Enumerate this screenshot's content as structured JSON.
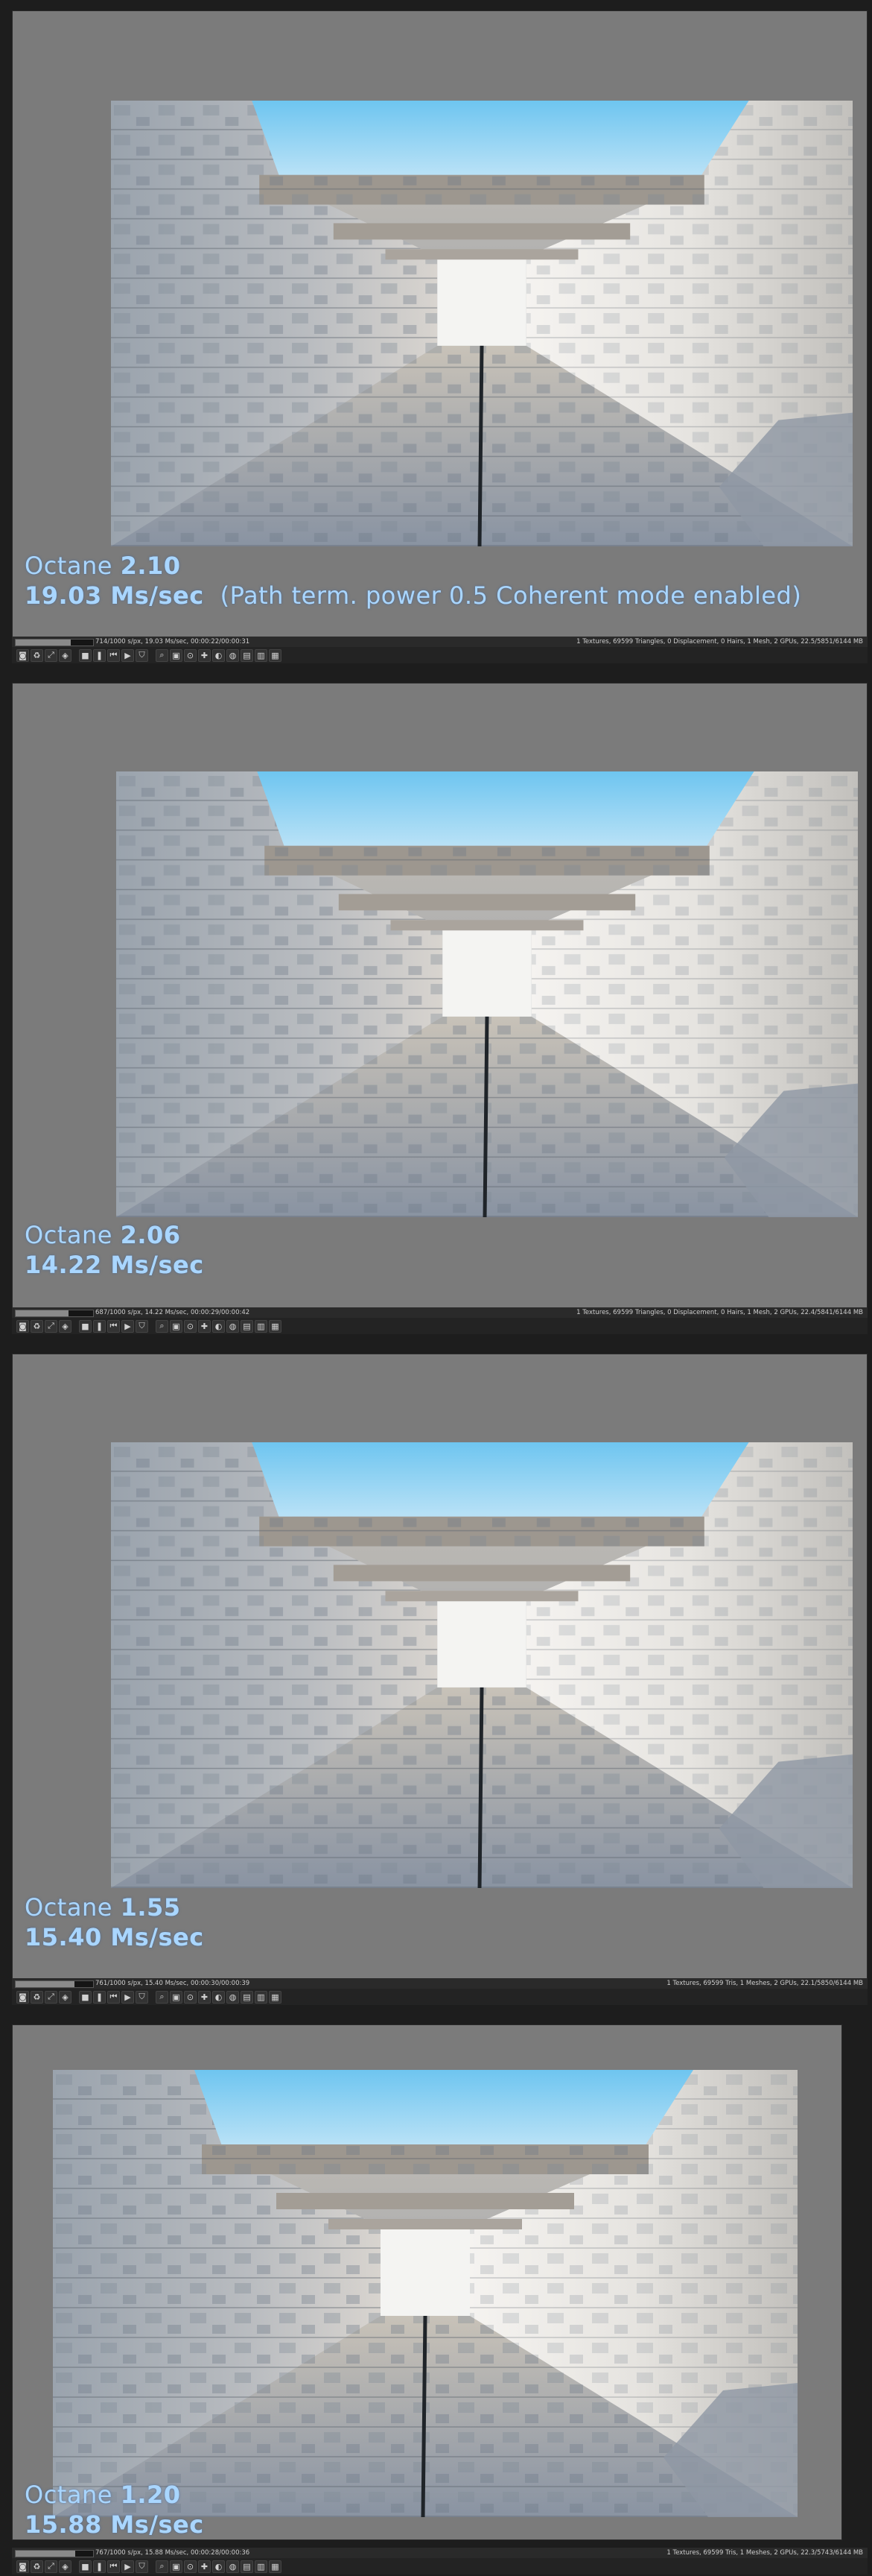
{
  "panels": [
    {
      "version_label": "Octane ",
      "version": "2.10",
      "speed": "19.03 Ms/sec",
      "extra": "(Path term. power 0.5  Coherent mode enabled)",
      "status_left": "714/1000 s/px, 19.03 Ms/sec, 00:00:22/00:00:31",
      "status_right": "1 Textures, 69599 Triangles, 0 Displacement, 0 Hairs, 1 Mesh, 2 GPUs, 22.5/5851/6144 MB",
      "progress": 0.714
    },
    {
      "version_label": "Octane ",
      "version": "2.06",
      "speed": "14.22 Ms/sec",
      "extra": "",
      "status_left": "687/1000 s/px, 14.22 Ms/sec, 00:00:29/00:00:42",
      "status_right": "1 Textures, 69599 Triangles, 0 Displacement, 0 Hairs, 1 Mesh, 2 GPUs, 22.4/5841/6144 MB",
      "progress": 0.687
    },
    {
      "version_label": "Octane ",
      "version": "1.55",
      "speed": "15.40 Ms/sec",
      "extra": "",
      "status_left": "761/1000 s/px, 15.40 Ms/sec, 00:00:30/00:00:39",
      "status_right": "1 Textures, 69599 Tris, 1 Meshes, 2 GPUs, 22.1/5850/6144 MB",
      "progress": 0.761
    },
    {
      "version_label": "Octane ",
      "version": "1.20",
      "speed": "15.88 Ms/sec",
      "extra": "",
      "status_left": "767/1000 s/px, 15.88 Ms/sec, 00:00:28/00:00:36",
      "status_right": "1 Textures, 69599 Tris, 1 Meshes, 2 GPUs, 22.3/5743/6144 MB",
      "progress": 0.767
    }
  ],
  "toolbar_icons": [
    "camera-icon",
    "recycle-icon",
    "fit-icon",
    "color-icon",
    "stop-icon",
    "pause-icon",
    "restart-icon",
    "play-icon",
    "lock-icon",
    "zoom-icon",
    "region-icon",
    "focus-icon",
    "pick-icon",
    "denoise-icon",
    "clay-icon",
    "sub-icon",
    "flat-icon",
    "save-icon"
  ],
  "colors": {
    "caption": "#a9d6ff",
    "viewport_bg": "#7b7b7b",
    "sky": "#7fcbf0",
    "stone": "#c9cdd3"
  }
}
